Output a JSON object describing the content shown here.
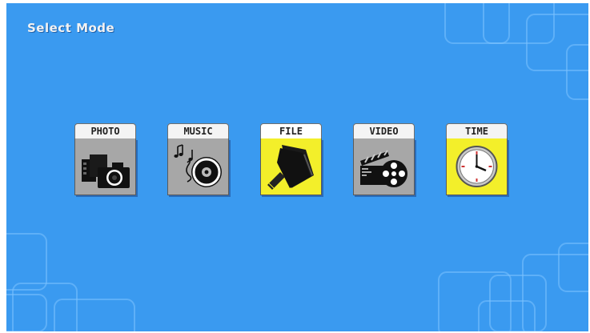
{
  "title": "Select Mode",
  "modes": [
    {
      "label": "PHOTO",
      "icon": "camera-photo-icon",
      "selected": false
    },
    {
      "label": "MUSIC",
      "icon": "music-cd-icon",
      "selected": false
    },
    {
      "label": "FILE",
      "icon": "file-folder-icon",
      "selected": true
    },
    {
      "label": "VIDEO",
      "icon": "film-reel-icon",
      "selected": false
    },
    {
      "label": "TIME",
      "icon": "clock-icon",
      "selected": false
    }
  ],
  "colors": {
    "background": "#3a9af0",
    "tile_default": "#a7a7a7",
    "tile_highlight": "#f3ef2a",
    "title_text": "#f2f2f2"
  }
}
